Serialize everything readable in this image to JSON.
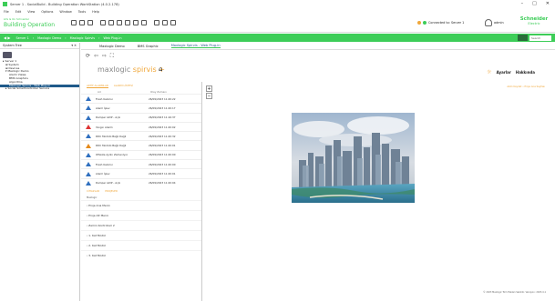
{
  "window": {
    "title": "Server 1 - SocialBuild - Building Operation WorkStation (4.0.2.178)",
    "controls": [
      "–",
      "□",
      "✕"
    ]
  },
  "menu": [
    "File",
    "Edit",
    "View",
    "Options",
    "Window",
    "Tools",
    "Help"
  ],
  "brand": {
    "top": "Life Is On Schneider",
    "name": "Building Operation"
  },
  "status": {
    "connected": "Connected to: Server 1",
    "user": "admin"
  },
  "logo": {
    "line1": "Schneider",
    "line2": "Electric"
  },
  "breadcrumb": [
    "Server 1",
    "Maxlogic Demo",
    "Maxlogic Spirvis",
    "Web Plug-in"
  ],
  "search": {
    "placeholder": "Search"
  },
  "system_tree": {
    "title": "System Tree",
    "items": [
      {
        "label": "▸ Server 1",
        "indent": 3
      },
      {
        "label": "⊞ System",
        "indent": 6
      },
      {
        "label": "⊞ Devices",
        "indent": 6
      },
      {
        "label": "▾ Maxlogic Demo",
        "indent": 6
      },
      {
        "label": "Alarm Views",
        "indent": 10
      },
      {
        "label": "BMS Graphics",
        "indent": 10
      },
      {
        "label": "Algoritma",
        "indent": 10
      },
      {
        "label": "Maxlogic Spirvis - Web Plug-in",
        "indent": 10,
        "selected": true
      },
      {
        "label": "▸ Social SmartController Service",
        "indent": 6
      }
    ]
  },
  "tabs": [
    {
      "label": "Maxlogic Demo",
      "active": false
    },
    {
      "label": "BMS Graphic",
      "active": false
    },
    {
      "label": "Maxlogic Spirvis - Web Plug-in",
      "active": true
    }
  ],
  "page_toolbar": "⟳ ⇦ ⇨ ⛶",
  "app": {
    "logo_main": "maxlogic",
    "logo_sub": " spirvis",
    "logo_plus": "+",
    "home_icon": "⌂",
    "settings_label": "Ayarlar",
    "about_label": "Hakkında",
    "sun_icon": "☼"
  },
  "alarm_panel": {
    "tabs": [
      "AKTİF ALARMLAR",
      "ALARM LİSTESİ"
    ],
    "columns": [
      "Ad",
      "Olay Zamanı"
    ],
    "rows": [
      {
        "name": "Fresh Kalorisi",
        "time": "26/09/2023 11:20:22",
        "level": "blue"
      },
      {
        "name": "Alarm İşlev",
        "time": "26/09/2023 11:20:17",
        "level": "blue"
      },
      {
        "name": "Damper Aktif - Açık",
        "time": "26/09/2023 11:16:37",
        "level": "blue"
      },
      {
        "name": "Yangın Alarmı",
        "time": "26/09/2023 11:20:02",
        "level": "red"
      },
      {
        "name": "DDC Modülü Bağlı Değil",
        "time": "26/09/2023 11:20:32",
        "level": "blue"
      },
      {
        "name": "DDC Modülü Bağlı Değil",
        "time": "26/09/2023 11:20:01",
        "level": "orange"
      },
      {
        "name": "Ofisiste Aydın Zamanlyıcı",
        "time": "26/09/2023 11:20:00",
        "level": "blue"
      },
      {
        "name": "Fresh Kalorisi",
        "time": "26/09/2023 11:20:00",
        "level": "blue"
      },
      {
        "name": "Alarm İşlev",
        "time": "26/09/2023 11:20:01",
        "level": "blue"
      },
      {
        "name": "Damper Aktif - Açık",
        "time": "26/09/2023 11:20:04",
        "level": "blue"
      }
    ],
    "bottom_tabs": [
      "CİHAZLAR",
      "PROJELER"
    ],
    "tree_root": "Maxlogic",
    "projects": [
      "Proje Ana Menü",
      "Proje Alt Menü",
      "Zemin Kontrolleri 2",
      "1. Kat Modül",
      "2. Kat Modül",
      "3. Kat Modül"
    ]
  },
  "main_panel": {
    "link": "Akıllı Kaydet • Proje Ana Sayfası",
    "zoom_in": "+",
    "zoom_out": "−",
    "footer": "© 2023 Maxlogic Tüm Hakları Saklıdır. Versiyon: 2023.4.1"
  }
}
